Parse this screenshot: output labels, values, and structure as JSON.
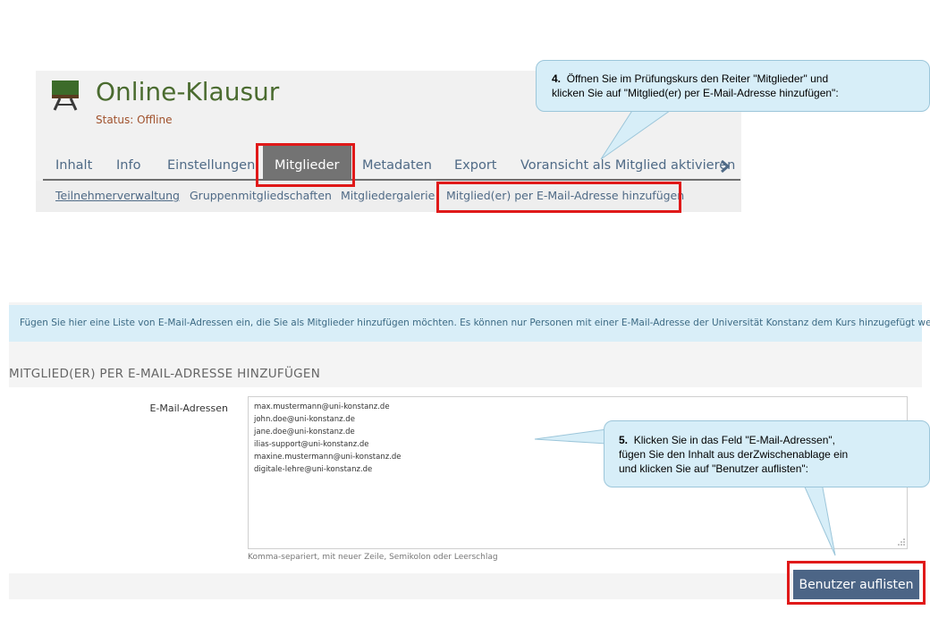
{
  "course": {
    "title": "Online-Klausur",
    "status": "Status: Offline",
    "tabs": [
      {
        "label": "Inhalt"
      },
      {
        "label": "Info"
      },
      {
        "label": "Einstellungen"
      },
      {
        "label": "Mitglieder",
        "active": true
      },
      {
        "label": "Metadaten"
      },
      {
        "label": "Export"
      },
      {
        "label": "Voransicht als Mitglied aktivieren"
      }
    ],
    "subtabs": [
      {
        "label": "Teilnehmerverwaltung"
      },
      {
        "label": "Gruppenmitgliedschaften"
      },
      {
        "label": "Mitgliedergalerie"
      },
      {
        "label": "Mitglied(er) per E-Mail-Adresse hinzufügen"
      }
    ]
  },
  "callouts": {
    "step4": {
      "number": "4.",
      "text_line1": "Öffnen Sie im Prüfungskurs den Reiter \"Mitglieder\" und",
      "text_line2": "klicken Sie auf \"Mitglied(er) per E-Mail-Adresse hinzufügen\":"
    },
    "step5": {
      "number": "5.",
      "text_line1": "Klicken Sie in das Feld \"E-Mail-Adressen\",",
      "text_line2": "fügen Sie den Inhalt aus derZwischenablage ein",
      "text_line3": "und klicken Sie auf \"Benutzer auflisten\":"
    }
  },
  "form": {
    "info_text": "Fügen Sie hier eine Liste von E-Mail-Adressen ein, die Sie als Mitglieder hinzufügen möchten. Es können nur Personen mit einer E-Mail-Adresse der Universität Konstanz dem Kurs hinzugefügt werden.",
    "section_title": "MITGLIED(ER) PER E-MAIL-ADRESSE HINZUFÜGEN",
    "field_label": "E-Mail-Adressen",
    "emails": [
      "max.mustermann@uni-konstanz.de",
      "john.doe@uni-konstanz.de",
      "jane.doe@uni-konstanz.de",
      "ilias-support@uni-konstanz.de",
      "maxine.mustermann@uni-konstanz.de",
      "digitale-lehre@uni-konstanz.de"
    ],
    "field_help": "Komma-separiert, mit neuer Zeile, Semikolon oder Leerschlag",
    "submit_label": "Benutzer auflisten"
  },
  "colors": {
    "highlight": "#e01919",
    "callout_bg": "#d7eef8",
    "button_bg": "#4c6586",
    "title_green": "#4a6b2f"
  }
}
